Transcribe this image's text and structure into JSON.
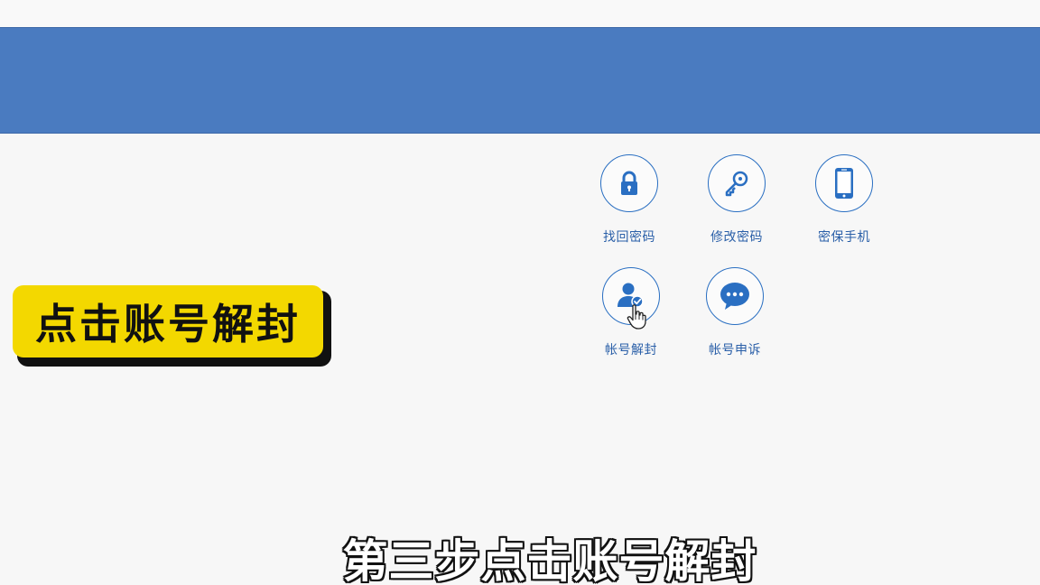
{
  "services": {
    "items": [
      {
        "label": "找回密码",
        "icon": "lock-icon"
      },
      {
        "label": "修改密码",
        "icon": "key-icon"
      },
      {
        "label": "密保手机",
        "icon": "phone-icon"
      },
      {
        "label": "帐号解封",
        "icon": "user-check-icon"
      },
      {
        "label": "帐号申诉",
        "icon": "chat-bubble-icon"
      }
    ]
  },
  "overlay": {
    "badge_text": "点击账号解封",
    "subtitle_text": "第三步点击账号解封"
  },
  "colors": {
    "header_band": "#4a7bc0",
    "accent_blue": "#2a6fc2",
    "badge_yellow": "#f3d800"
  }
}
